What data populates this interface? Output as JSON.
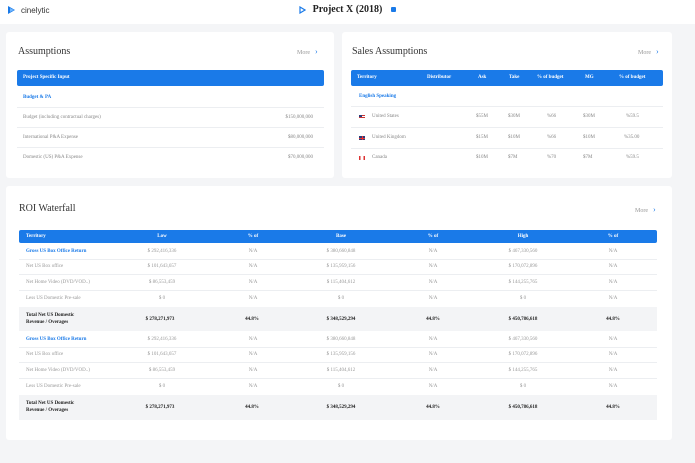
{
  "header": {
    "brand": "cinelytic",
    "project_title": "Project X (2018)"
  },
  "assumptions": {
    "title": "Assumptions",
    "more": "More",
    "bar_label": "Project Specific Input",
    "section": "Budget & PA",
    "rows": [
      {
        "label": "Budget (including contractual charges)",
        "value": "$150,000,000"
      },
      {
        "label": "International P&A Expense",
        "value": "$80,000,000"
      },
      {
        "label": "Domestic (US) P&A Expense",
        "value": "$70,000,000"
      }
    ]
  },
  "sales": {
    "title": "Sales Assumptions",
    "more": "More",
    "headers": [
      "Territory",
      "Distributor",
      "Ask",
      "Take",
      "% of budget",
      "MG",
      "% of budget"
    ],
    "section": "English Speaking",
    "rows": [
      {
        "flag": "us-flag-icon",
        "territory": "United States",
        "ask": "$55M",
        "take": "$30M",
        "pct1": "%66",
        "mg": "$30M",
        "pct2": "%59.5"
      },
      {
        "flag": "uk-flag-icon",
        "territory": "United Kingdom",
        "ask": "$15M",
        "take": "$10M",
        "pct1": "%66",
        "mg": "$10M",
        "pct2": "%35.00"
      },
      {
        "flag": "ca-flag-icon",
        "territory": "Canada",
        "ask": "$10M",
        "take": "$7M",
        "pct1": "%70",
        "mg": "$7M",
        "pct2": "%59.5"
      }
    ]
  },
  "roi": {
    "title": "ROI Waterfall",
    "more": "More",
    "headers": [
      "Territory",
      "Low",
      "% of",
      "Base",
      "% of",
      "High",
      "% of"
    ],
    "groups": [
      {
        "rows": [
          {
            "label": "Gross US Box Office Return",
            "low": "$ 292,416,336",
            "p1": "N/A",
            "base": "$ 380,660,848",
            "p2": "N/A",
            "high": "$ 467,330,560",
            "p3": "N/A"
          },
          {
            "label": "Net US Box office",
            "low": "$ 101,643,657",
            "p1": "N/A",
            "base": "$ 135,959,156",
            "p2": "N/A",
            "high": "$ 170,072,896",
            "p3": "N/A"
          },
          {
            "label": "Net Home Video (DVD/VOD..)",
            "low": "$ 86,553,459",
            "p1": "N/A",
            "base": "$ 115,404,612",
            "p2": "N/A",
            "high": "$ 144,255,765",
            "p3": "N/A"
          },
          {
            "label": "Less US Domestic Pre-sale",
            "low": "$ 0",
            "p1": "N/A",
            "base": "$ 0",
            "p2": "N/A",
            "high": "$ 0",
            "p3": "N/A"
          }
        ],
        "total": {
          "label1": "Total Net US Domestic",
          "label2": "Revenue / Overages",
          "low": "$ 278,271,973",
          "p1": "44.8%",
          "base": "$ 348,529,294",
          "p2": "44.8%",
          "high": "$ 450,786,618",
          "p3": "44.8%"
        }
      },
      {
        "rows": [
          {
            "label": "Gross US Box Office Return",
            "low": "$ 292,416,336",
            "p1": "N/A",
            "base": "$ 380,660,848",
            "p2": "N/A",
            "high": "$ 467,330,560",
            "p3": "N/A"
          },
          {
            "label": "Net US Box office",
            "low": "$ 101,643,657",
            "p1": "N/A",
            "base": "$ 135,959,156",
            "p2": "N/A",
            "high": "$ 170,072,896",
            "p3": "N/A"
          },
          {
            "label": "Net Home Video (DVD/VOD..)",
            "low": "$ 86,553,459",
            "p1": "N/A",
            "base": "$ 115,404,612",
            "p2": "N/A",
            "high": "$ 144,255,765",
            "p3": "N/A"
          },
          {
            "label": "Less US Domestic Pre-sale",
            "low": "$ 0",
            "p1": "N/A",
            "base": "$ 0",
            "p2": "N/A",
            "high": "$ 0",
            "p3": "N/A"
          }
        ],
        "total": {
          "label1": "Total Net US Domestic",
          "label2": "Revenue / Overages",
          "low": "$ 278,271,973",
          "p1": "44.8%",
          "base": "$ 348,529,294",
          "p2": "44.8%",
          "high": "$ 450,786,618",
          "p3": "44.8%"
        }
      }
    ]
  }
}
